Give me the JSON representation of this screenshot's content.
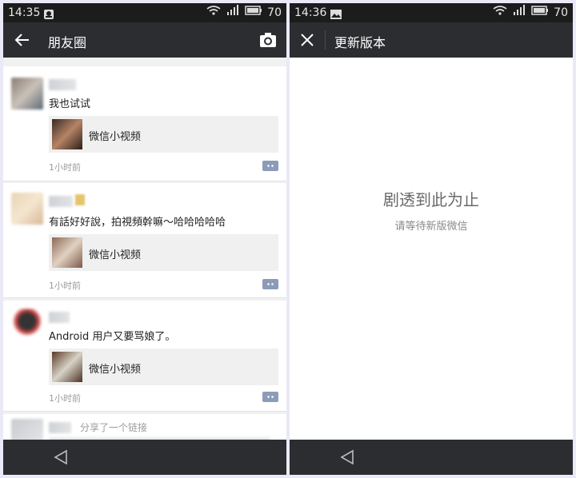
{
  "left": {
    "status": {
      "time": "14:35",
      "battery": "70"
    },
    "appbar": {
      "title": "朋友圈"
    },
    "posts": [
      {
        "text": "我也试试",
        "video_label": "微信小视频",
        "time_ago": "1小时前"
      },
      {
        "text": "有話好好說，拍視頻幹嘛～哈哈哈哈哈",
        "video_label": "微信小视频",
        "time_ago": "1小时前"
      },
      {
        "text": "Android 用户又要骂娘了。",
        "video_label": "微信小视频",
        "time_ago": "1小时前"
      },
      {
        "share_text": "分享了一个链接"
      }
    ]
  },
  "right": {
    "status": {
      "time": "14:36",
      "battery": "70"
    },
    "appbar": {
      "title": "更新版本"
    },
    "message": "剧透到此为止",
    "sub_message": "请等待新版微信"
  },
  "icons": [
    "back-arrow-icon",
    "camera-icon",
    "close-icon",
    "nav-back-icon",
    "wifi-icon",
    "signal-icon",
    "battery-icon",
    "notification-icon",
    "image-icon"
  ]
}
